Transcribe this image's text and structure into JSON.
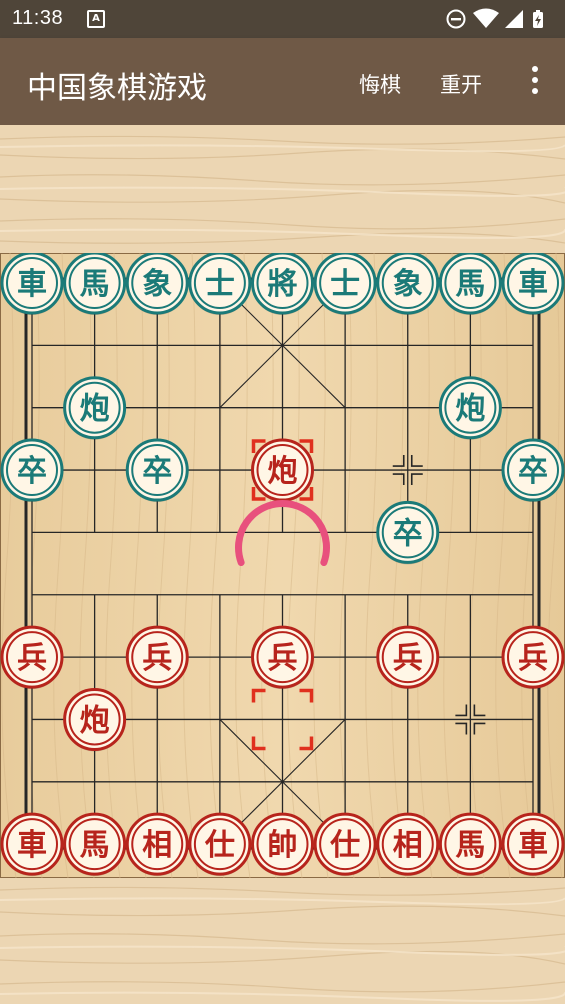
{
  "status_bar": {
    "time": "11:38",
    "notification_icon": "text-a-icon",
    "icons": [
      "do-not-disturb-icon",
      "wifi-icon",
      "signal-icon",
      "battery-charging-icon"
    ]
  },
  "app_bar": {
    "title": "中国象棋游戏",
    "actions": {
      "undo": "悔棋",
      "restart": "重开"
    },
    "menu_icon": "more-vert-icon"
  },
  "colors": {
    "status_bar": "#4f4539",
    "app_bar": "#6f5946",
    "board_wood": "#ecd3a6",
    "board_line": "#262626",
    "teal_piece": "#1b7a78",
    "red_piece": "#b7241c",
    "piece_face": "#fff6e6",
    "selection": "#e0301e",
    "spinner": "#e8507d"
  },
  "board": {
    "files": 9,
    "ranks": 10,
    "river_text": "",
    "selected_piece": {
      "file": 4,
      "rank": 3
    },
    "move_origin": {
      "file": 4,
      "rank": 7
    },
    "loading_spinner": true,
    "pieces": [
      {
        "file": 0,
        "rank": 0,
        "side": "teal",
        "char": "車",
        "name": "teal-chariot"
      },
      {
        "file": 1,
        "rank": 0,
        "side": "teal",
        "char": "馬",
        "name": "teal-horse"
      },
      {
        "file": 2,
        "rank": 0,
        "side": "teal",
        "char": "象",
        "name": "teal-elephant"
      },
      {
        "file": 3,
        "rank": 0,
        "side": "teal",
        "char": "士",
        "name": "teal-advisor"
      },
      {
        "file": 4,
        "rank": 0,
        "side": "teal",
        "char": "將",
        "name": "teal-general"
      },
      {
        "file": 5,
        "rank": 0,
        "side": "teal",
        "char": "士",
        "name": "teal-advisor"
      },
      {
        "file": 6,
        "rank": 0,
        "side": "teal",
        "char": "象",
        "name": "teal-elephant"
      },
      {
        "file": 7,
        "rank": 0,
        "side": "teal",
        "char": "馬",
        "name": "teal-horse"
      },
      {
        "file": 8,
        "rank": 0,
        "side": "teal",
        "char": "車",
        "name": "teal-chariot"
      },
      {
        "file": 1,
        "rank": 2,
        "side": "teal",
        "char": "炮",
        "name": "teal-cannon"
      },
      {
        "file": 7,
        "rank": 2,
        "side": "teal",
        "char": "炮",
        "name": "teal-cannon"
      },
      {
        "file": 0,
        "rank": 3,
        "side": "teal",
        "char": "卒",
        "name": "teal-soldier"
      },
      {
        "file": 2,
        "rank": 3,
        "side": "teal",
        "char": "卒",
        "name": "teal-soldier"
      },
      {
        "file": 8,
        "rank": 3,
        "side": "teal",
        "char": "卒",
        "name": "teal-soldier"
      },
      {
        "file": 6,
        "rank": 4,
        "side": "teal",
        "char": "卒",
        "name": "teal-soldier"
      },
      {
        "file": 4,
        "rank": 3,
        "side": "red",
        "char": "炮",
        "name": "red-cannon"
      },
      {
        "file": 0,
        "rank": 6,
        "side": "red",
        "char": "兵",
        "name": "red-soldier"
      },
      {
        "file": 2,
        "rank": 6,
        "side": "red",
        "char": "兵",
        "name": "red-soldier"
      },
      {
        "file": 4,
        "rank": 6,
        "side": "red",
        "char": "兵",
        "name": "red-soldier"
      },
      {
        "file": 6,
        "rank": 6,
        "side": "red",
        "char": "兵",
        "name": "red-soldier"
      },
      {
        "file": 8,
        "rank": 6,
        "side": "red",
        "char": "兵",
        "name": "red-soldier"
      },
      {
        "file": 1,
        "rank": 7,
        "side": "red",
        "char": "炮",
        "name": "red-cannon"
      },
      {
        "file": 0,
        "rank": 9,
        "side": "red",
        "char": "車",
        "name": "red-chariot"
      },
      {
        "file": 1,
        "rank": 9,
        "side": "red",
        "char": "馬",
        "name": "red-horse"
      },
      {
        "file": 2,
        "rank": 9,
        "side": "red",
        "char": "相",
        "name": "red-elephant"
      },
      {
        "file": 3,
        "rank": 9,
        "side": "red",
        "char": "仕",
        "name": "red-advisor"
      },
      {
        "file": 4,
        "rank": 9,
        "side": "red",
        "char": "帥",
        "name": "red-general"
      },
      {
        "file": 5,
        "rank": 9,
        "side": "red",
        "char": "仕",
        "name": "red-advisor"
      },
      {
        "file": 6,
        "rank": 9,
        "side": "red",
        "char": "相",
        "name": "red-elephant"
      },
      {
        "file": 7,
        "rank": 9,
        "side": "red",
        "char": "馬",
        "name": "red-horse"
      },
      {
        "file": 8,
        "rank": 9,
        "side": "red",
        "char": "車",
        "name": "red-chariot"
      }
    ]
  }
}
